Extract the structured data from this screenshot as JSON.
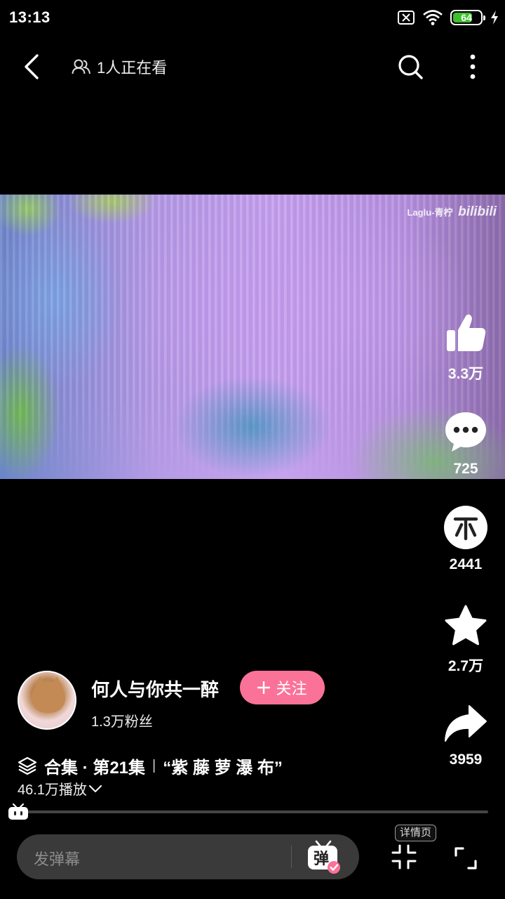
{
  "status_bar": {
    "time": "13:13",
    "battery_level": "64"
  },
  "top_nav": {
    "viewers_text": "1人正在看"
  },
  "video": {
    "watermark_author": "Laglu-青柠",
    "watermark_brand": "bilibili",
    "progress": 0.02
  },
  "actions": {
    "likes": "3.3万",
    "comments": "725",
    "coins": "2441",
    "favorites": "2.7万",
    "shares": "3959"
  },
  "uploader": {
    "name": "何人与你共一醉",
    "followers": "1.3万粉丝",
    "follow_label": "关注"
  },
  "video_info": {
    "collection": "合集 · 第21集",
    "title": "“紫 藤 萝 瀑 布”",
    "plays": "46.1万播放"
  },
  "bottom_bar": {
    "danmaku_placeholder": "发弹幕",
    "danmaku_toggle_label": "弹",
    "detail_tip": "详情页"
  },
  "colors": {
    "accent": "#fb7299",
    "battery_fill": "#3fbf2f"
  }
}
